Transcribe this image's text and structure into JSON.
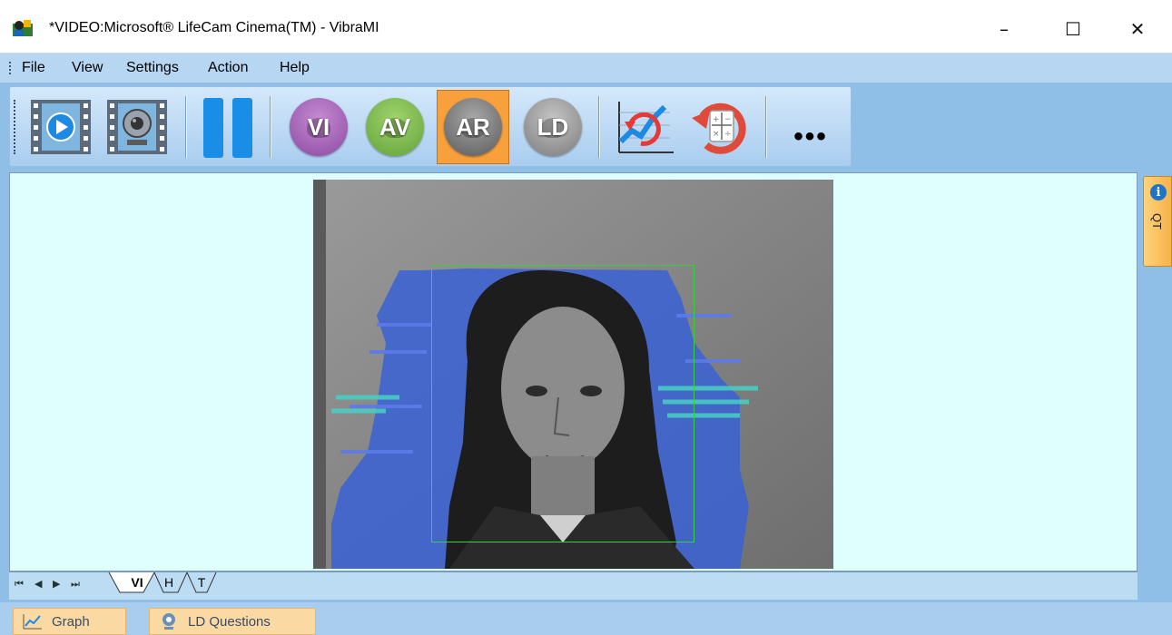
{
  "window": {
    "title": "*VIDEO:Microsoft® LifeCam Cinema(TM) - VibraMI",
    "minimize_glyph": "–",
    "maximize_glyph": "☐",
    "close_glyph": "✕"
  },
  "menu": {
    "items": [
      {
        "label": "File"
      },
      {
        "label": "View"
      },
      {
        "label": "Settings"
      },
      {
        "label": "Action"
      },
      {
        "label": "Help"
      }
    ]
  },
  "toolbar": {
    "buttons": [
      {
        "name": "play-video",
        "icon": "film-play-icon"
      },
      {
        "name": "webcam",
        "icon": "film-webcam-icon"
      },
      {
        "name": "pause",
        "icon": "pause-icon"
      },
      {
        "name": "mode-vi",
        "label": "VI",
        "color": "#b34fc7",
        "active": false
      },
      {
        "name": "mode-av",
        "label": "AV",
        "color": "#b34fc7",
        "active": false
      },
      {
        "name": "mode-ar",
        "label": "AR",
        "color": "#707070",
        "active": true
      },
      {
        "name": "mode-ld",
        "label": "LD",
        "color": "#7a7a7a",
        "active": false
      },
      {
        "name": "graph-refresh",
        "icon": "chart-refresh-icon"
      },
      {
        "name": "reset-calc",
        "icon": "calculator-reset-icon"
      },
      {
        "name": "more",
        "label": "•••"
      }
    ]
  },
  "side_panel": {
    "label": "QT",
    "icon": "info-icon",
    "icon_glyph": "i"
  },
  "video": {
    "face_box_color": "#36d13d"
  },
  "sheet_tabs": {
    "nav": [
      "⏮",
      "◀",
      "▶",
      "⏭"
    ],
    "tabs": [
      {
        "label": "VI",
        "active": true
      },
      {
        "label": "H",
        "active": false
      },
      {
        "label": "T",
        "active": false
      }
    ]
  },
  "bottom": {
    "graph_label": "Graph",
    "ld_questions_label": "LD Questions"
  },
  "colors": {
    "accent_active": "#f8a13c",
    "panel_bg": "#dfffff",
    "chrome_blue": "#a9cdef"
  }
}
